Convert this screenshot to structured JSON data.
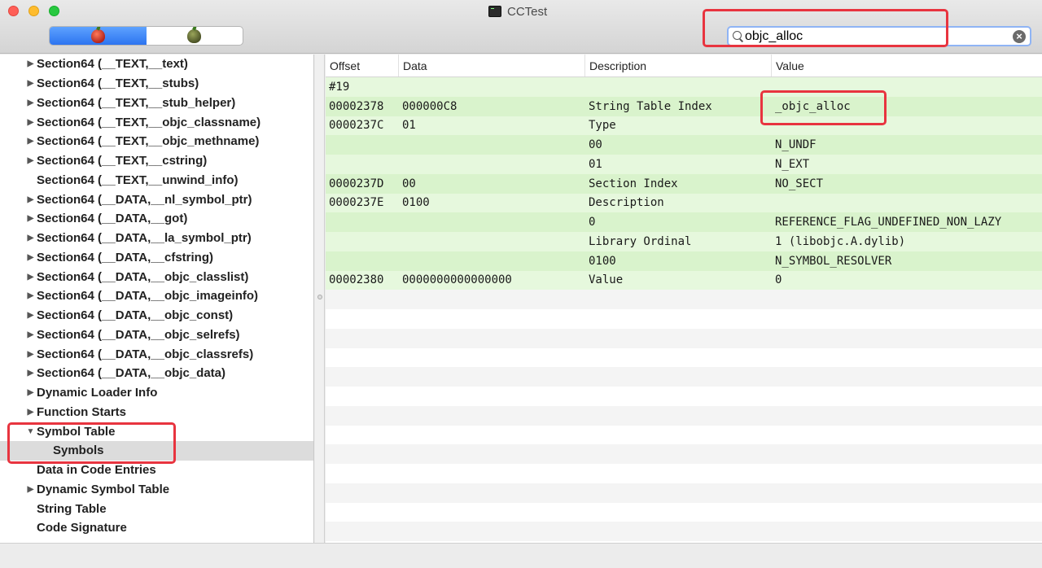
{
  "window": {
    "title": "CCTest",
    "terminal_icon": "terminal-icon"
  },
  "toolbar": {
    "segments": [
      {
        "icon": "red-apple-icon",
        "active": true
      },
      {
        "icon": "green-apple-icon",
        "active": false
      }
    ],
    "search": {
      "value": "objc_alloc",
      "icon": "search-icon",
      "clear_icon": "clear-icon"
    }
  },
  "sidebar": {
    "items": [
      {
        "label": "Section64 (__TEXT,__text)",
        "expandable": true
      },
      {
        "label": "Section64 (__TEXT,__stubs)",
        "expandable": true
      },
      {
        "label": "Section64 (__TEXT,__stub_helper)",
        "expandable": true
      },
      {
        "label": "Section64 (__TEXT,__objc_classname)",
        "expandable": true
      },
      {
        "label": "Section64 (__TEXT,__objc_methname)",
        "expandable": true
      },
      {
        "label": "Section64 (__TEXT,__cstring)",
        "expandable": true
      },
      {
        "label": "Section64 (__TEXT,__unwind_info)",
        "expandable": false
      },
      {
        "label": "Section64 (__DATA,__nl_symbol_ptr)",
        "expandable": true
      },
      {
        "label": "Section64 (__DATA,__got)",
        "expandable": true
      },
      {
        "label": "Section64 (__DATA,__la_symbol_ptr)",
        "expandable": true
      },
      {
        "label": "Section64 (__DATA,__cfstring)",
        "expandable": true
      },
      {
        "label": "Section64 (__DATA,__objc_classlist)",
        "expandable": true
      },
      {
        "label": "Section64 (__DATA,__objc_imageinfo)",
        "expandable": true
      },
      {
        "label": "Section64 (__DATA,__objc_const)",
        "expandable": true
      },
      {
        "label": "Section64 (__DATA,__objc_selrefs)",
        "expandable": true
      },
      {
        "label": "Section64 (__DATA,__objc_classrefs)",
        "expandable": true
      },
      {
        "label": "Section64 (__DATA,__objc_data)",
        "expandable": true
      },
      {
        "label": "Dynamic Loader Info",
        "expandable": true
      },
      {
        "label": "Function Starts",
        "expandable": true
      },
      {
        "label": "Symbol Table",
        "expandable": true,
        "expanded": true
      },
      {
        "label": "Symbols",
        "child": true,
        "selected": true
      },
      {
        "label": "Data in Code Entries",
        "expandable": false
      },
      {
        "label": "Dynamic Symbol Table",
        "expandable": true
      },
      {
        "label": "String Table",
        "expandable": false
      },
      {
        "label": "Code Signature",
        "expandable": false
      }
    ]
  },
  "table": {
    "columns": [
      "Offset",
      "Data",
      "Description",
      "Value"
    ],
    "rows": [
      [
        "#19",
        "",
        "",
        ""
      ],
      [
        "00002378",
        "000000C8",
        "String Table Index",
        "_objc_alloc"
      ],
      [
        "0000237C",
        "01",
        "Type",
        ""
      ],
      [
        "",
        "",
        "00",
        "N_UNDF"
      ],
      [
        "",
        "",
        "01",
        "N_EXT"
      ],
      [
        "0000237D",
        "00",
        "Section Index",
        "NO_SECT"
      ],
      [
        "0000237E",
        "0100",
        "Description",
        ""
      ],
      [
        "",
        "",
        "0",
        "REFERENCE_FLAG_UNDEFINED_NON_LAZY"
      ],
      [
        "",
        "",
        "Library Ordinal",
        "1 (libobjc.A.dylib)"
      ],
      [
        "",
        "",
        "0100",
        "N_SYMBOL_RESOLVER"
      ],
      [
        "00002380",
        "0000000000000000",
        "Value",
        "0"
      ]
    ]
  },
  "colors": {
    "highlight_row": "#e6f8dd",
    "annotation": "#e8343f",
    "segment_active": "#2c74f0"
  }
}
